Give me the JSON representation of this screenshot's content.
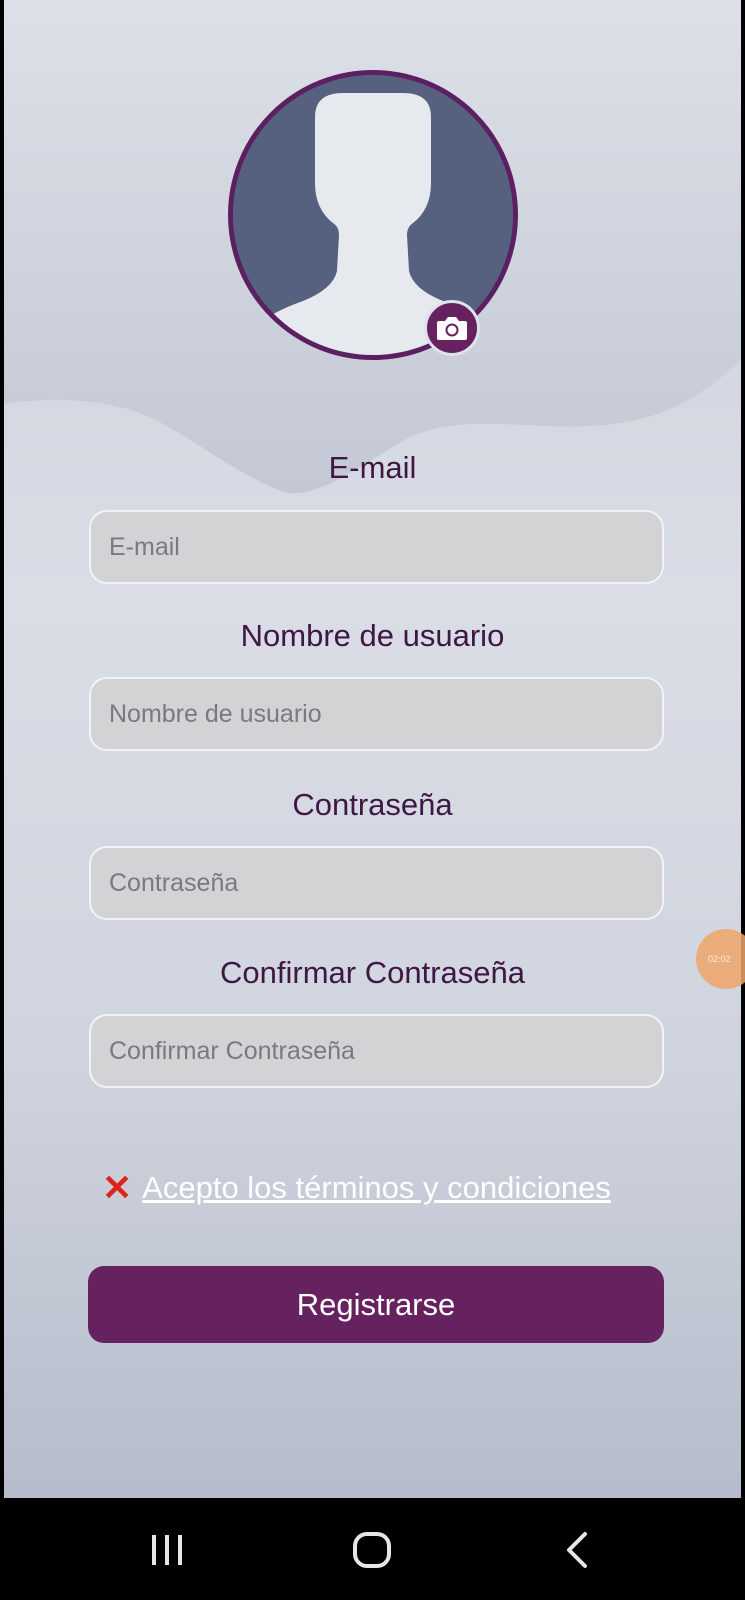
{
  "avatar": {
    "icon": "user-silhouette-icon",
    "camera_icon": "camera-icon"
  },
  "form": {
    "email": {
      "label": "E-mail",
      "placeholder": "E-mail",
      "value": ""
    },
    "username": {
      "label": "Nombre de usuario",
      "placeholder": "Nombre de usuario",
      "value": ""
    },
    "password": {
      "label": "Contraseña",
      "placeholder": "Contraseña",
      "value": ""
    },
    "confirm_password": {
      "label": "Confirmar Contraseña",
      "placeholder": "Confirmar Contraseña",
      "value": ""
    }
  },
  "terms": {
    "status_icon": "✕",
    "label": "Acepto los términos y condiciones"
  },
  "register_button": {
    "label": "Registrarse"
  },
  "floating_bubble": {
    "text": "02:02"
  },
  "navbar": {
    "recents_icon": "recents-icon",
    "home_icon": "home-icon",
    "back_icon": "back-icon"
  },
  "colors": {
    "accent": "#66225f",
    "label_text": "#3e1744",
    "input_bg": "#d3d3d6",
    "error_x": "#e0221c",
    "avatar_bg": "#56617f"
  }
}
